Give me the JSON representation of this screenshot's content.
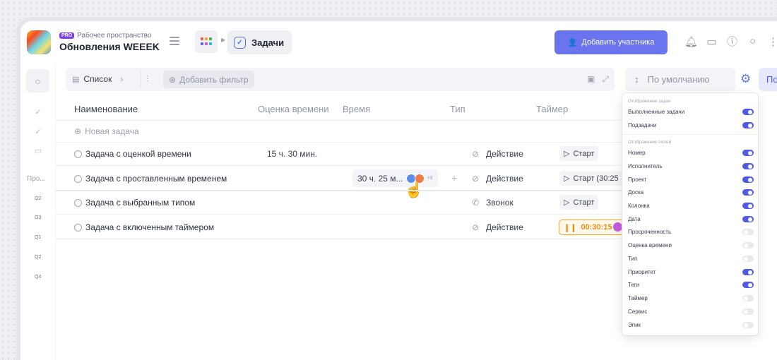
{
  "header": {
    "pro_badge": "PRO",
    "workspace_label": "Рабочее пространство",
    "workspace_name": "Обновления WEEEK",
    "tab_label": "Задачи",
    "add_member_label": "Добавить участника",
    "accent_color": "#6a74ee"
  },
  "rail": {
    "projects_label": "Про...",
    "items": [
      "O2",
      "O3",
      "Q1",
      "Q2",
      "Q4"
    ]
  },
  "toolbar": {
    "view_label": "Список",
    "add_filter_label": "Добавить фильтр",
    "sort_label": "По умолчанию",
    "right_button_label": "По"
  },
  "table": {
    "columns": [
      "Наименование",
      "Оценка времени",
      "Время",
      "Тип",
      "Таймер"
    ],
    "new_task_label": "Новая задача",
    "rows": [
      {
        "name": "Задача с оценкой времени",
        "estimate": "15 ч. 30 мин.",
        "type": "Действие",
        "timer": "Старт"
      },
      {
        "name": "Задача с проставленным временем",
        "time": "30 ч. 25 м...",
        "avatars_extra": "+6",
        "type": "Действие",
        "timer": "Старт (30:25"
      },
      {
        "name": "Задача с выбранным типом",
        "type": "Звонок",
        "timer": "Старт"
      },
      {
        "name": "Задача с включенным таймером",
        "type": "Действие",
        "timer": "00:30:15"
      }
    ]
  },
  "dropdown": {
    "section1": "Отображение задач",
    "section1_items": [
      {
        "label": "Выполненные задачи",
        "on": true
      },
      {
        "label": "Подзадачи",
        "on": true
      }
    ],
    "section2": "Отображение полей",
    "section2_items": [
      {
        "label": "Номер",
        "on": true
      },
      {
        "label": "Исполнитель",
        "on": true
      },
      {
        "label": "Проект",
        "on": true
      },
      {
        "label": "Доска",
        "on": true
      },
      {
        "label": "Колонка",
        "on": true
      },
      {
        "label": "Дата",
        "on": true
      },
      {
        "label": "Просроченность",
        "on": false
      },
      {
        "label": "Оценка времени",
        "on": false
      },
      {
        "label": "Тип",
        "on": false
      },
      {
        "label": "Приоритет",
        "on": true
      },
      {
        "label": "Теги",
        "on": true
      },
      {
        "label": "Таймер",
        "on": false
      },
      {
        "label": "Сервис",
        "on": false
      },
      {
        "label": "Эпик",
        "on": false
      }
    ]
  }
}
